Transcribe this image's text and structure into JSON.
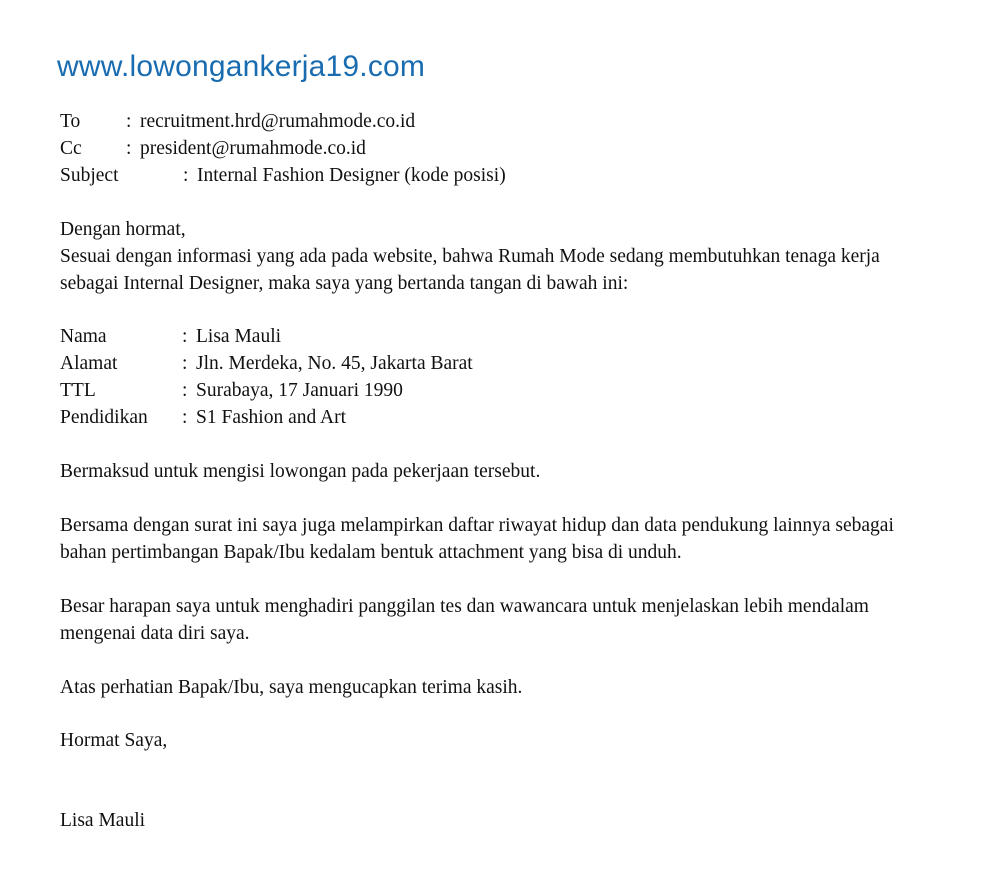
{
  "site": {
    "url": "www.lowongankerja19.com",
    "url_color": "#1a6cb0"
  },
  "letter": {
    "header_fields": [
      {
        "label": "To",
        "separator": ":",
        "value": "recruitment.hrd@rumahmode.co.id"
      },
      {
        "label": "Cc",
        "separator": ":",
        "value": "president@rumahmode.co.id"
      },
      {
        "label": "Subject",
        "separator": ":",
        "value": "Internal Fashion Designer (kode posisi)"
      }
    ],
    "salutation": "Dengan hormat,",
    "intro_paragraph": "Sesuai dengan informasi yang ada pada website, bahwa Rumah Mode sedang membutuhkan tenaga kerja sebagai Internal Designer, maka saya yang bertanda tangan di bawah ini:",
    "personal_data": [
      {
        "label": "Nama",
        "separator": ":",
        "value": "Lisa Mauli"
      },
      {
        "label": "Alamat",
        "separator": ":",
        "value": "Jln. Merdeka, No. 45, Jakarta Barat"
      },
      {
        "label": "TTL",
        "separator": ":",
        "value": "Surabaya, 17 Januari 1990"
      },
      {
        "label": "Pendidikan",
        "separator": ":",
        "value": "S1 Fashion and Art"
      }
    ],
    "body_paragraphs": [
      "Bermaksud untuk mengisi lowongan pada pekerjaan tersebut.",
      "Bersama dengan surat ini saya juga melampirkan daftar riwayat hidup dan data pendukung lainnya sebagai bahan pertimbangan Bapak/Ibu kedalam bentuk attachment yang bisa di unduh.",
      "Besar harapan saya untuk menghadiri panggilan tes dan wawancara untuk menjelaskan lebih mendalam mengenai data diri saya.",
      "Atas perhatian Bapak/Ibu, saya mengucapkan terima kasih."
    ],
    "closing": "Hormat Saya,",
    "signature_name": "Lisa Mauli"
  }
}
